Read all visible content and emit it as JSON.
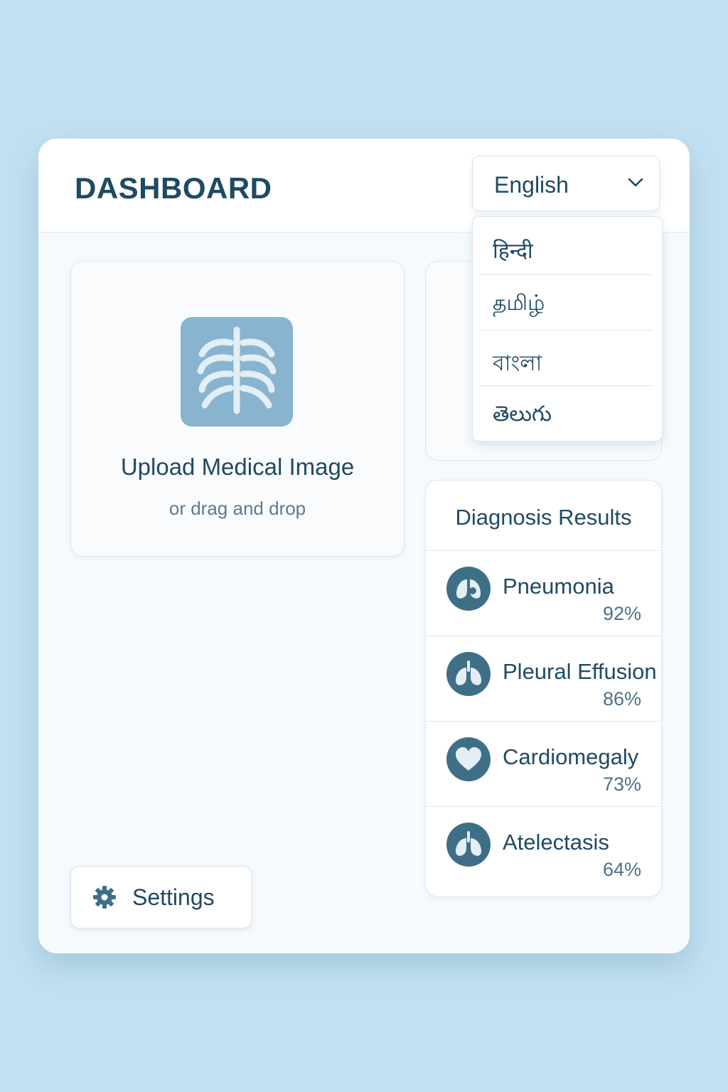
{
  "header": {
    "title": "DASHBOARD"
  },
  "language": {
    "selected": "English",
    "options": [
      "हिन्दी",
      "தமிழ்",
      "বাংলা",
      "తెలుగు"
    ]
  },
  "upload": {
    "title": "Upload Medical Image",
    "subtitle": "or drag and drop",
    "icon": "chest-xray-icon"
  },
  "results": {
    "title": "Diagnosis Results",
    "items": [
      {
        "name": "Pneumonia",
        "confidence": "92%",
        "icon": "lungs-icon"
      },
      {
        "name": "Pleural Effusion",
        "confidence": "86%",
        "icon": "lungs-icon"
      },
      {
        "name": "Cardiomegaly",
        "confidence": "73%",
        "icon": "heart-icon"
      },
      {
        "name": "Atelectasis",
        "confidence": "64%",
        "icon": "lungs-icon"
      }
    ]
  },
  "settings": {
    "label": "Settings",
    "icon": "gear-icon"
  },
  "colors": {
    "background": "#c2e0f1",
    "primary_text": "#1f4a63",
    "icon_fill": "#3f6f87",
    "upload_icon_bg": "#88b4d0"
  }
}
